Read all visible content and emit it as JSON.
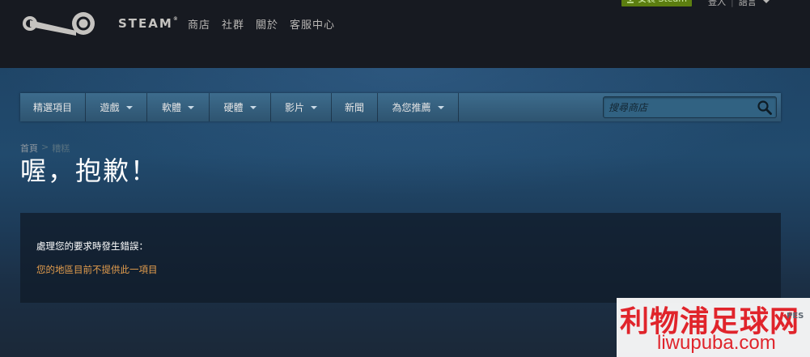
{
  "header": {
    "logo_text": "STEAM",
    "logo_tm": "®",
    "nav": [
      "商店",
      "社群",
      "關於",
      "客服中心"
    ],
    "install_label": "安裝 Steam",
    "login_label": "登入",
    "login_separator": "|",
    "language_label": "語言"
  },
  "store_nav": {
    "tabs": [
      {
        "label": "精選項目",
        "dropdown": false
      },
      {
        "label": "遊戲",
        "dropdown": true
      },
      {
        "label": "軟體",
        "dropdown": true
      },
      {
        "label": "硬體",
        "dropdown": true
      },
      {
        "label": "影片",
        "dropdown": true
      },
      {
        "label": "新聞",
        "dropdown": false
      },
      {
        "label": "為您推薦",
        "dropdown": true
      }
    ],
    "search_placeholder": "搜尋商店"
  },
  "breadcrumb": {
    "home": "首頁",
    "separator": ">",
    "current": "糟糕"
  },
  "page": {
    "title": "喔，抱歉！",
    "error_heading": "處理您的要求時發生錯誤：",
    "error_message": "您的地區目前不提供此一項目"
  },
  "watermark": {
    "title": "利物浦足球网",
    "url": "liwupuba.com",
    "side_text": "PES"
  },
  "colors": {
    "page_bg": "#1b2838",
    "header_bg": "#171a21",
    "nav_bg": "#3d6c8d",
    "error_text": "#e39d4d",
    "install_bg": "#5c7e10"
  }
}
